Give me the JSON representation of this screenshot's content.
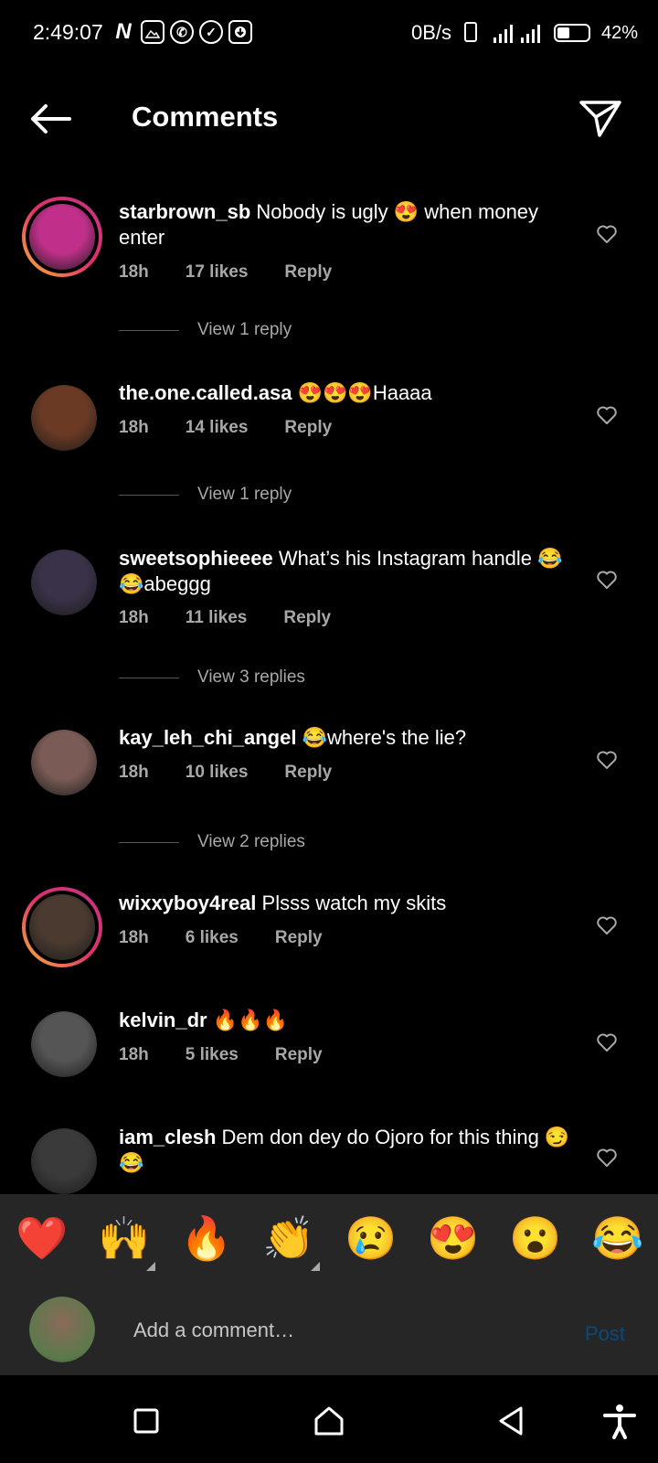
{
  "status_bar": {
    "time": "2:49:07",
    "network_speed": "0B/s",
    "battery_percent": "42%",
    "battery_level": 0.42,
    "icons": [
      "netflix-icon",
      "gallery-icon",
      "whatsapp-icon",
      "check-circle-icon",
      "download-icon"
    ]
  },
  "header": {
    "title": "Comments"
  },
  "comments": [
    {
      "user": "starbrown_sb",
      "text": " Nobody is ugly 😍 when money enter",
      "time": "18h",
      "likes": "17 likes",
      "reply": "Reply",
      "view_replies": "View 1 reply",
      "avatar_color": "#c0308a",
      "has_story": true
    },
    {
      "user": "the.one.called.asa",
      "text": " 😍😍😍Haaaa",
      "time": "18h",
      "likes": "14 likes",
      "reply": "Reply",
      "view_replies": "View 1 reply",
      "avatar_color": "#6b3a25",
      "has_story": false
    },
    {
      "user": "sweetsophieeee",
      "text": " What’s his Instagram handle 😂😂abeggg",
      "time": "18h",
      "likes": "11 likes",
      "reply": "Reply",
      "view_replies": "View 3 replies",
      "avatar_color": "#3a3248",
      "has_story": false
    },
    {
      "user": "kay_leh_chi_angel",
      "text": " 😂where's the lie?",
      "time": "18h",
      "likes": "10 likes",
      "reply": "Reply",
      "view_replies": "View 2 replies",
      "avatar_color": "#7a5b55",
      "has_story": false
    },
    {
      "user": "wixxyboy4real",
      "text": " Plsss watch my skits",
      "time": "18h",
      "likes": "6 likes",
      "reply": "Reply",
      "view_replies": "",
      "avatar_color": "#4a3a30",
      "has_story": true
    },
    {
      "user": "kelvin_dr",
      "text": " 🔥🔥🔥",
      "time": "18h",
      "likes": "5 likes",
      "reply": "Reply",
      "view_replies": "",
      "avatar_color": "#555555",
      "has_story": false
    },
    {
      "user": "iam_clesh",
      "text": " Dem don dey do Ojoro for this thing 😏😂",
      "time": "",
      "likes": "",
      "reply": "",
      "view_replies": "",
      "avatar_color": "#3a3a3a",
      "has_story": false
    }
  ],
  "emoji_bar": [
    "❤️",
    "🙌",
    "🔥",
    "👏",
    "😢",
    "😍",
    "😮",
    "😂"
  ],
  "comment_input": {
    "placeholder": "Add a comment…",
    "post_label": "Post"
  },
  "nav_bar": [
    "recents-button",
    "home-button",
    "back-button",
    "accessibility-button"
  ]
}
